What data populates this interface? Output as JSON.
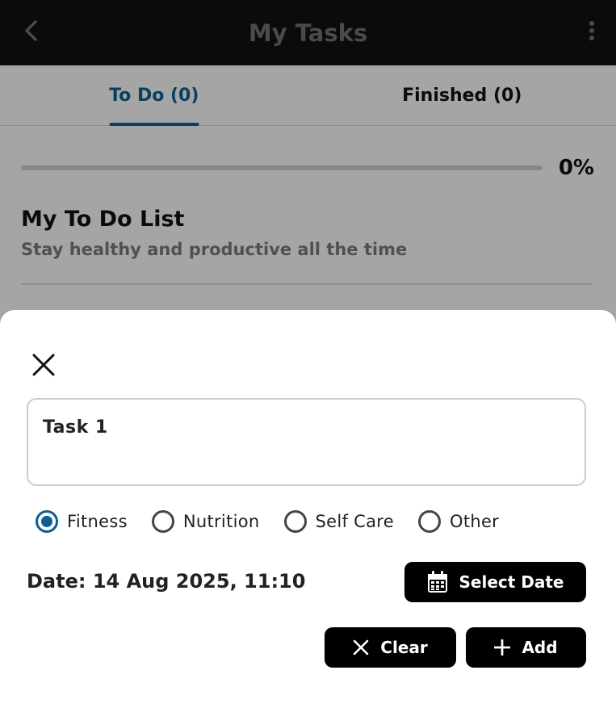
{
  "appbar": {
    "title": "My Tasks",
    "back_icon": "chevron-left-icon",
    "more_icon": "more-vert-icon"
  },
  "tabs": [
    {
      "label": "To Do (0)",
      "active": true
    },
    {
      "label": "Finished (0)",
      "active": false
    }
  ],
  "progress": {
    "value": 0,
    "label": "0%"
  },
  "list": {
    "title": "My To Do List",
    "subtitle": "Stay healthy and productive all the time"
  },
  "sheet": {
    "close_icon": "close-icon",
    "task_value": "Task 1",
    "categories": [
      {
        "label": "Fitness",
        "checked": true
      },
      {
        "label": "Nutrition",
        "checked": false
      },
      {
        "label": "Self Care",
        "checked": false
      },
      {
        "label": "Other",
        "checked": false
      }
    ],
    "date_text": "Date: 14 Aug 2025, 11:10",
    "select_date_label": "Select Date",
    "clear_label": "Clear",
    "add_label": "Add"
  },
  "colors": {
    "accent": "#0d5f8f",
    "appbar": "#111111",
    "button": "#000000"
  }
}
